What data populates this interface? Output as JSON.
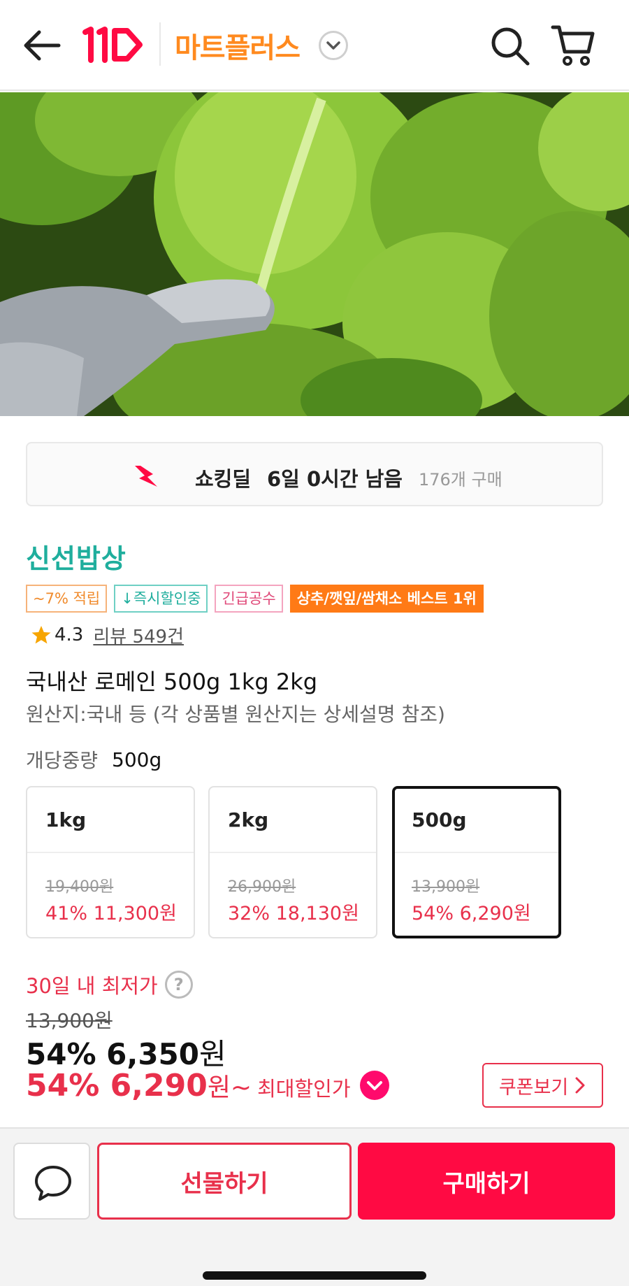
{
  "header": {
    "back_icon": "arrow-left-icon",
    "logo_icon": "eleven-street-logo",
    "store_name": "마트플러스",
    "store_dropdown_icon": "chevron-down-icon",
    "search_icon": "search-icon",
    "cart_icon": "cart-icon"
  },
  "hero": {
    "image": "romaine-lettuce-photo-gloved-hand"
  },
  "deal": {
    "icon": "shocking-deal-icon",
    "label": "쇼킹딜",
    "time_left": "6일 0시간 남음",
    "purchase_count": "176개 구매"
  },
  "seller": {
    "name": "신선밥상"
  },
  "badges": [
    "~7% 적립",
    "↓즉시할인중",
    "긴급공수",
    "상추/깻잎/쌈채소 베스트 1위"
  ],
  "rating": {
    "star_icon": "star-icon",
    "value": "4.3",
    "review_label": "리뷰 549건"
  },
  "product": {
    "title": "국내산 로메인 500g 1kg 2kg",
    "origin": "원산지:국내 등 (각 상품별 원산지는 상세설명 참조)"
  },
  "weight": {
    "label": "개당중량",
    "value": "500g"
  },
  "options": [
    {
      "name": "1kg",
      "original_price": "19,400원",
      "sale": "41% 11,300원",
      "selected": false
    },
    {
      "name": "2kg",
      "original_price": "26,900원",
      "sale": "32% 18,130원",
      "selected": false
    },
    {
      "name": "500g",
      "original_price": "13,900원",
      "sale": "54% 6,290원",
      "selected": true
    }
  ],
  "pricing": {
    "lowest_label": "30일 내 최저가",
    "help_icon": "question-circle-icon",
    "help_text": "?",
    "original_price": "13,900원",
    "price_pct_amount": "54% 6,350",
    "price_won": "원",
    "max_pct_amount": "54% 6,290",
    "max_won": "원~",
    "max_label": "최대할인가",
    "max_check_icon": "check-circle-icon"
  },
  "coupon": {
    "label": "쿠폰보기",
    "icon": "chevron-right-icon"
  },
  "bottom_bar": {
    "chat_icon": "chat-bubble-icon",
    "gift_label": "선물하기",
    "buy_label": "구매하기"
  },
  "colors": {
    "accent_red": "#e8304b",
    "buy_red": "#ff0a43",
    "store_orange": "#ff8a1f",
    "seller_teal": "#1fae9d",
    "badge_orange": "#ff7a16"
  }
}
